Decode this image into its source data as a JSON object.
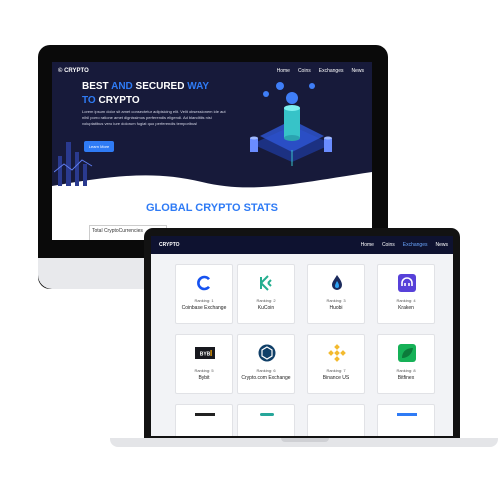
{
  "desktop": {
    "logo": "© CRYPTO",
    "nav": [
      "Home",
      "Coins",
      "Exchanges",
      "News"
    ],
    "headline": {
      "part1": "BEST",
      "accent1": "AND",
      "part2": "SECURED",
      "accent2": "WAY",
      "part3": "TO",
      "part4": "CRYPTO"
    },
    "paragraph": "Lorem ipsum dolor sit amet consectetur adipisicing elit. Velit obsessionem ide aut nihil porro ratione amet dignissimos perferendis eligendi. Ad blanditiis nisi voluptatibus vero iure dolorum fugiat quo perferendis temporibus!",
    "button": "Learn More",
    "stats_title": "GLOBAL CRYPTO STATS",
    "stats_box": "Total CryptoCurrencies"
  },
  "laptop": {
    "logo": "CRYPTO",
    "nav": [
      "Home",
      "Coins",
      "Exchanges",
      "News"
    ],
    "active_nav": "Exchanges",
    "exchanges": [
      {
        "ranking": "Ranking: 1",
        "name": "Coinbase Exchange",
        "icon": "coinbase-icon"
      },
      {
        "ranking": "Ranking: 2",
        "name": "KuCoin",
        "icon": "kucoin-icon"
      },
      {
        "ranking": "Ranking: 3",
        "name": "Huobi",
        "icon": "huobi-icon"
      },
      {
        "ranking": "Ranking: 4",
        "name": "Kraken",
        "icon": "kraken-icon"
      },
      {
        "ranking": "Ranking: 5",
        "name": "Bybit",
        "icon": "bybit-icon"
      },
      {
        "ranking": "Ranking: 6",
        "name": "Crypto.com Exchange",
        "icon": "cryptocom-icon"
      },
      {
        "ranking": "Ranking: 7",
        "name": "Binance US",
        "icon": "binance-icon"
      },
      {
        "ranking": "Ranking: 8",
        "name": "Bitfinex",
        "icon": "bitfinex-icon"
      }
    ]
  },
  "colors": {
    "accent": "#2f7bf5",
    "hero_bg": "#171a3a",
    "nav_bg": "#0e1230",
    "active_link": "#6aa6ff"
  }
}
